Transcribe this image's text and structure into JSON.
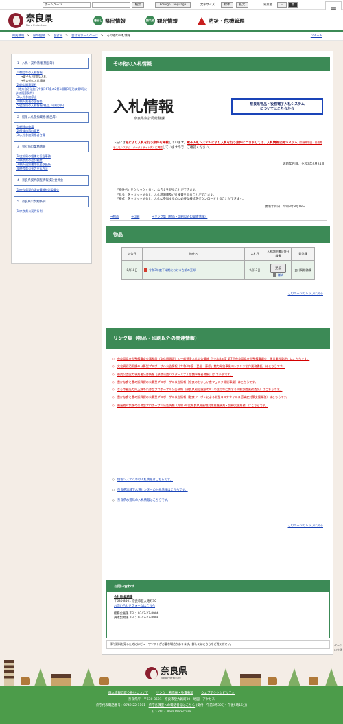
{
  "topbar": {
    "select": "ホームページ",
    "search_btn": "検索",
    "foreign_btn": "Foreign Language",
    "fontsize_label": "文字サイズ",
    "fontsize_std": "標準",
    "fontsize_big": "拡大",
    "bg_label": "背景色",
    "bg_white": "白",
    "bg_black": "黒",
    "menu_label": "メニュー"
  },
  "header": {
    "logo": "奈良県",
    "logo_sub": "Nara Prefecture",
    "nav": [
      {
        "badge": "暮らし",
        "label": "県民情報"
      },
      {
        "badge": "訪れる",
        "label": "観光情報"
      },
      {
        "badge": "",
        "label": "防災・危機管理"
      }
    ]
  },
  "breadcrumb": [
    "県民情報",
    "県の組織",
    "会計局",
    "会計局ホームページ",
    "その他の入札情報"
  ],
  "tweet": "ツイート",
  "sidebar": {
    "sec1": "1　入札・契約情報(物品等)",
    "sec1_items": [
      {
        "t": "(1)物品等の入札情報",
        "link": true
      },
      {
        "t": "→電子入札(物品入札)",
        "link": false
      },
      {
        "t": "→その他の入札情報",
        "link": false
      },
      {
        "t": "(2)特定随意契約",
        "link": true
      },
      {
        "t": "（地方自治法施行令第167条の2第1項第3号又は第4号による随意契約）",
        "link": true
      },
      {
        "t": "(3)入札参加停止",
        "link": true
      },
      {
        "t": "(4)納入業者の苦情等",
        "link": true
      },
      {
        "t": "(5)会計局の入札情報(物品、印刷以外)",
        "link": true
      }
    ],
    "sec2": "2　競争入札参加資格(物品等)",
    "sec2_items": [
      "(1)新規の申請",
      "(2)登録内容の変更",
      "(3)入札参加資格者名簿"
    ],
    "sec3": "3　会計局の業務情報",
    "sec3_items": [
      "(1)会計局の組織と担当事務",
      "(2)奈良県の会計制度",
      "(3)納入通知書等収金取扱所",
      "(4)奈良県公金の支払方法"
    ],
    "sec4": "4　奈良県契約調査情報検討委員会",
    "sec4_items": [
      "(1)奈良県契約調査情報検討委員会"
    ],
    "sec5": "5　奈良県公契約条例",
    "sec5_items": [
      "(1)奈良県公契約条例"
    ]
  },
  "main": {
    "title": "その他の入札情報",
    "nyusatsu": "入札情報",
    "nyusatsu_sub": "奈良県会計局総務課",
    "sys_link_l1": "奈良県物品・役務電子入札システム",
    "sys_link_l2": "についてはこちらから",
    "notice_a": "下記には",
    "notice_b": "紙により入札を行う案件を掲載",
    "notice_c": "しています。",
    "notice_d": "電子入札システムにより入札を行う案件につきましては、入札情報公開システム",
    "notice_e": "（奈良県物品・役務電子入札システム　ポータルサイト内）に掲載",
    "notice_f": "していますので、ご確認ください。",
    "updated1": "更新年月日：令和3年9月24日",
    "instr": [
      "「物件名」をクリックすると、公告文を見ることができます。",
      "「見る」をクリックすると、入札説明書及び仕様書を見ることができます。",
      "「様式」をクリックすると、入札に参加するのに必要な様式をダウンロードすることができます。"
    ],
    "updated2": "更新年月日：令和3年8月18日",
    "anchors": [
      "⇒物品",
      "⇒印刷",
      "⇒リンク集（物品・印刷以外の関連情報）"
    ],
    "goods_title": "物品",
    "table": {
      "headers": [
        "公告日",
        "物件名",
        "入札日",
        "入札説明書及び仕様書",
        "発注課"
      ],
      "row": {
        "date": "8月18日",
        "name": "令和3年度下半期における古紙の売却",
        "bid_date": "9月13日",
        "see": "見る",
        "form": "様式",
        "dept": "会計局総務課"
      }
    },
    "to_top": "このページのトップに戻る",
    "links_title": "リンク集（物品・印刷以外の関連情報）",
    "links": [
      "奈良県県庁舎整備審査会事務局（文化振興課）の一般競争入札公告情報［「令和3年度 第7回奈良県県庁舎整備審議会」運営業務委託」はこちらです。",
      "文化資源活用課の公募型プロポーザル公告情報［令和3年度「民俗・藤原」魅力発信事業コンテンツ制作業務委託］はこちらです。",
      "奈良公園室の事業者公募情報［奈良公園バスターミナル店舗事業者募集］は コチラです。",
      "豊かな食と農の振興課の公募型プロポーザル公告情報［奈良のおいしい食フェスタ開催事業］はこちらです。",
      "ならの観光力向上課の公募型プロポーザル公告情報（奈良県宿泊施設のICTの活用等に関する実態調査業務委託）はこちらです。",
      "豊かな食と農の振興課の公募型プロポーザル公告情報（飲食クーポンによる新型コロナウイルス感染症対策支援業務）はこちらです。",
      "廃棄物対策課の公募型プロポーザル公告情報（令和3年度奈良県廃棄物対策推進事業・訓練実施業務）はこちらです。"
    ],
    "info": [
      "情報システム等の入札情報はこちらです。",
      "奈良県流域下水道センターの入札情報はこちらです。",
      "奈良県水道局の入札情報はこちらです。"
    ],
    "contact": {
      "title": "お問い合わせ",
      "dept": "会計局 総務課",
      "address": "〒630-8501 奈良市登大路町30",
      "form": "お問い合わせフォームはこちら",
      "tel1": "総務企画係 TEL：0742-27-8906",
      "tel2": "調達契約係 TEL：0742-27-8908"
    },
    "viewer": "添付資料を見るためにはビューワソフトが必要な場合があります。詳しくはこちらをご覧ください。"
  },
  "footer": {
    "logo": "奈良県",
    "logo_sub": "Nara Prefecture",
    "links": [
      "個人情報の取り扱いについて",
      "リンク・著作権・免責事項",
      "ウェブアクセシビリティ"
    ],
    "address": "奈良県庁　〒630-8501　奈良市登大路町30",
    "map": "地図・アクセス",
    "tel": "県庁代表電話番号：0742-22-1101",
    "dept_guide": "県庁各課室への電話番号はこちら",
    "hours": "(受付：午前8時30分〜午後5時15分)",
    "copyright": "(C) 2013 Nara Prefecture",
    "pagetop": "ページの先頭"
  }
}
